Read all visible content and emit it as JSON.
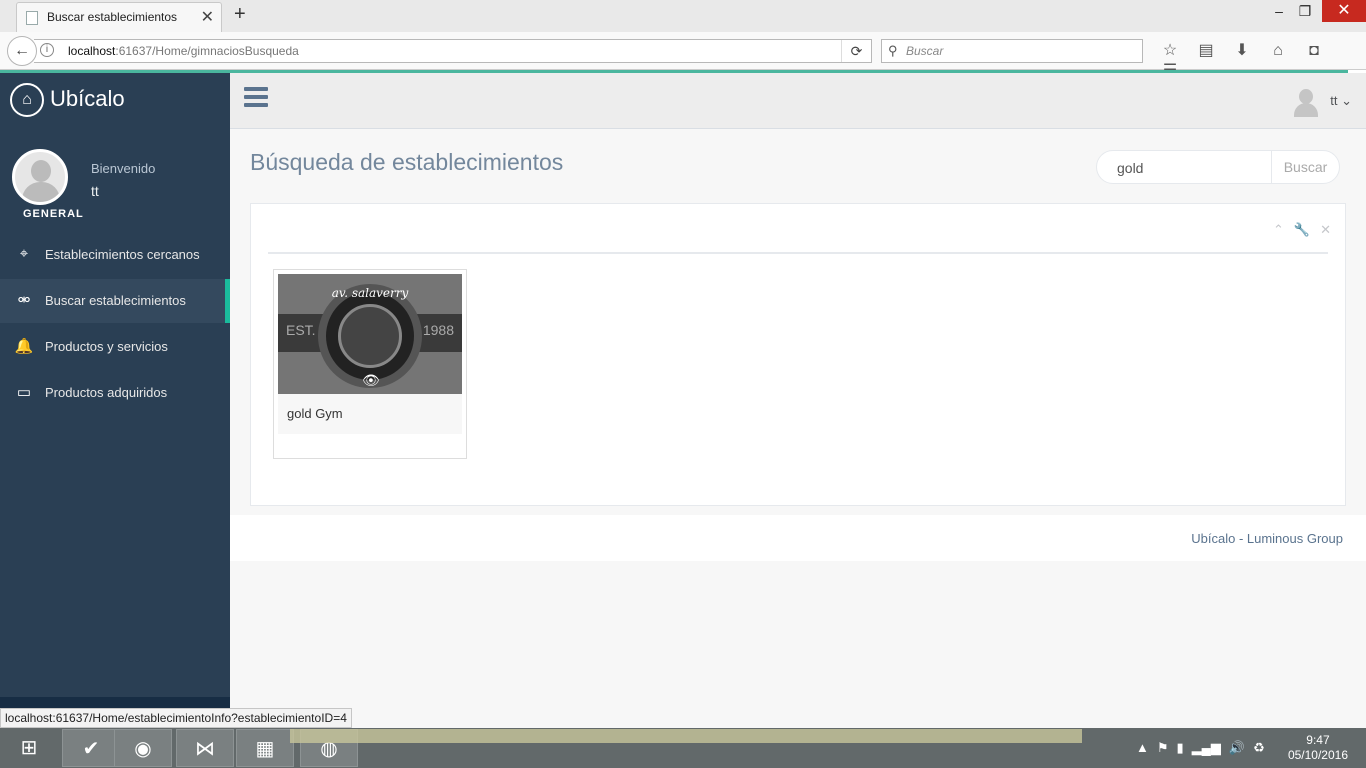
{
  "browser": {
    "tab_title": "Buscar establecimientos",
    "url_host": "localhost",
    "url_rest": ":61637/Home/gimnaciosBusqueda",
    "search_placeholder": "Buscar",
    "status_link": "localhost:61637/Home/establecimientoInfo?establecimientoID=4"
  },
  "sidebar": {
    "brand": "Ubícalo",
    "welcome": "Bienvenido",
    "username": "tt",
    "role": "GENERAL",
    "items": [
      {
        "label": "Establecimientos cercanos",
        "icon": "crosshairs-icon"
      },
      {
        "label": "Buscar establecimientos",
        "icon": "binoculars-icon"
      },
      {
        "label": "Productos y servicios",
        "icon": "bell-icon"
      },
      {
        "label": "Productos adquiridos",
        "icon": "credit-card-icon"
      }
    ]
  },
  "topnav": {
    "username": "tt"
  },
  "main": {
    "title": "Búsqueda de establecimientos",
    "search_value": "gold",
    "search_button": "Buscar",
    "results": [
      {
        "name": "gold Gym",
        "image_caption": "av. salaverry",
        "image_est": "EST.",
        "image_year": "1988"
      }
    ]
  },
  "footer": {
    "text": "Ubícalo - Luminous Group"
  },
  "taskbar": {
    "time": "9:47",
    "date": "05/10/2016"
  }
}
